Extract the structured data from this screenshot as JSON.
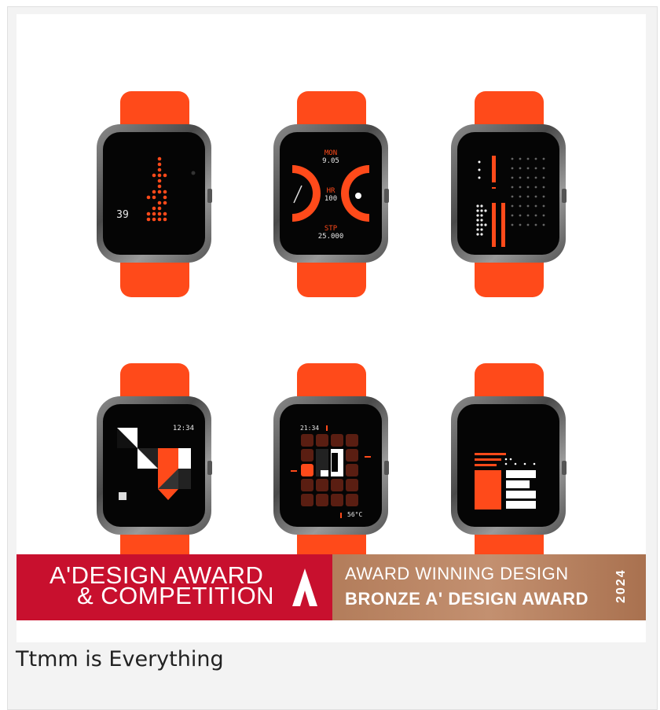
{
  "banner": {
    "left_line1": "A'DESIGN AWARD",
    "left_line2": "& COMPETITION",
    "right_line1": "AWARD WINNING DESIGN",
    "right_line2": "BRONZE A' DESIGN AWARD",
    "year": "2024"
  },
  "caption": "Ttmm is Everything",
  "watches": {
    "w1": {
      "num": "39"
    },
    "w2": {
      "mon_label": "MON",
      "mon_val": "9.05",
      "hr_label": "HR",
      "hr_val": "100",
      "stp_label": "STP",
      "stp_val": "25.000"
    },
    "w4": {
      "time": "12:34"
    },
    "w5": {
      "time": "21:34",
      "temp": "56°C"
    }
  },
  "colors": {
    "strap": "#ff4a1a",
    "award_red": "#c8102e",
    "bronze": "#b37d5b"
  }
}
